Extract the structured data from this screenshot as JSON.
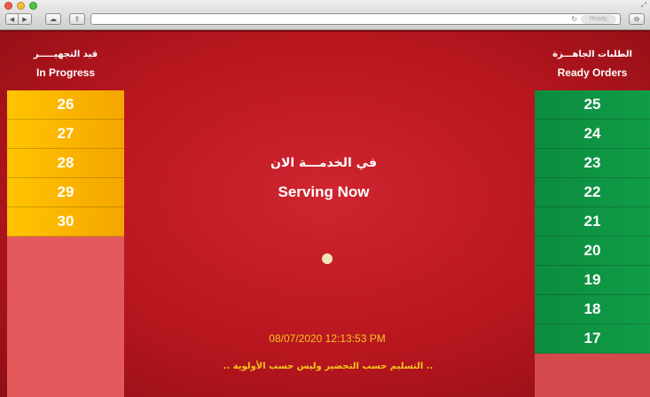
{
  "browser": {
    "status_text": "Ready",
    "back_icon": "back-arrow-icon",
    "forward_icon": "forward-arrow-icon"
  },
  "in_progress": {
    "title_ar": "قيد التجهيـــــر",
    "title_en": "In Progress",
    "orders": [
      "26",
      "27",
      "28",
      "29",
      "30"
    ]
  },
  "ready": {
    "title_ar": "الطلبات الجاهـــزة",
    "title_en": "Ready Orders",
    "orders": [
      "25",
      "24",
      "23",
      "22",
      "21",
      "20",
      "19",
      "18",
      "17"
    ]
  },
  "serving": {
    "title_ar": "في الخدمـــة الان",
    "title_en": "Serving Now",
    "current": ""
  },
  "datetime": "08/07/2020 12:13:53 PM",
  "footer_note": ".. التسليم حسب التحضير وليس حسب الأولوية ..",
  "colors": {
    "background": "#b8161f",
    "in_progress": "#ffc400",
    "ready": "#0c8c3f",
    "accent_text": "#f3c61a"
  }
}
